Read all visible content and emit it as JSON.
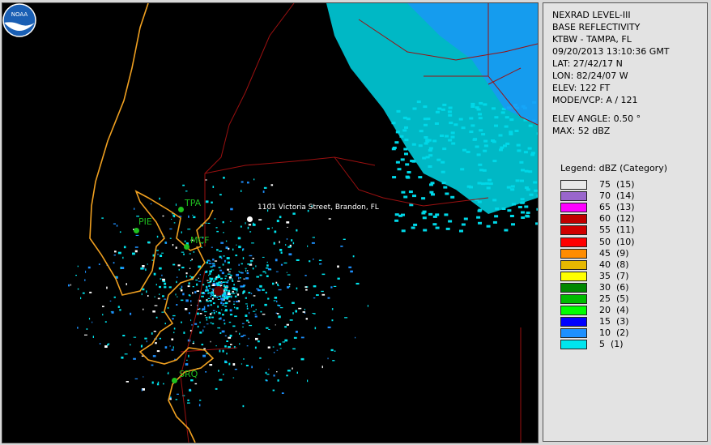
{
  "map": {
    "address_label": "1101 Victoria Street, Brandon, FL",
    "places": [
      {
        "id": "TPA",
        "label": "TPA"
      },
      {
        "id": "PIE",
        "label": "PIE"
      },
      {
        "id": "MCF",
        "label": "MCF"
      },
      {
        "id": "SRQ",
        "label": "SRQ"
      }
    ],
    "colors": {
      "coast": "#f0a020",
      "counties": "#9b1010",
      "background": "#000000",
      "label": "#1fbf1f"
    },
    "logo": "NOAA"
  },
  "info": {
    "product": "NEXRAD LEVEL-III",
    "type": "BASE REFLECTIVITY",
    "station": "KTBW - TAMPA, FL",
    "datetime": "09/20/2013 13:10:36 GMT",
    "lat": "LAT: 27/42/17 N",
    "lon": "LON: 82/24/07 W",
    "elev": "ELEV: 122 FT",
    "mode": "MODE/VCP: A / 121",
    "elev_angle": "ELEV ANGLE: 0.50 °",
    "max": "MAX: 52 dBZ"
  },
  "legend": {
    "title": "Legend: dBZ (Category)",
    "items": [
      {
        "label": "75  (15)",
        "color": "#e8e8e8"
      },
      {
        "label": "70  (14)",
        "color": "#9966cc"
      },
      {
        "label": "65  (13)",
        "color": "#ff00ff"
      },
      {
        "label": "60  (12)",
        "color": "#c00000"
      },
      {
        "label": "55  (11)",
        "color": "#d00000"
      },
      {
        "label": "50  (10)",
        "color": "#ff0000"
      },
      {
        "label": "45  (9)",
        "color": "#ff8c00"
      },
      {
        "label": "40  (8)",
        "color": "#e6b800"
      },
      {
        "label": "35  (7)",
        "color": "#ffff00"
      },
      {
        "label": "30  (6)",
        "color": "#008800"
      },
      {
        "label": "25  (5)",
        "color": "#00bb00"
      },
      {
        "label": "20  (4)",
        "color": "#00ff00"
      },
      {
        "label": "15  (3)",
        "color": "#0000ff"
      },
      {
        "label": "10  (2)",
        "color": "#1e90ff"
      },
      {
        "label": "5  (1)",
        "color": "#00e5ee"
      }
    ]
  }
}
